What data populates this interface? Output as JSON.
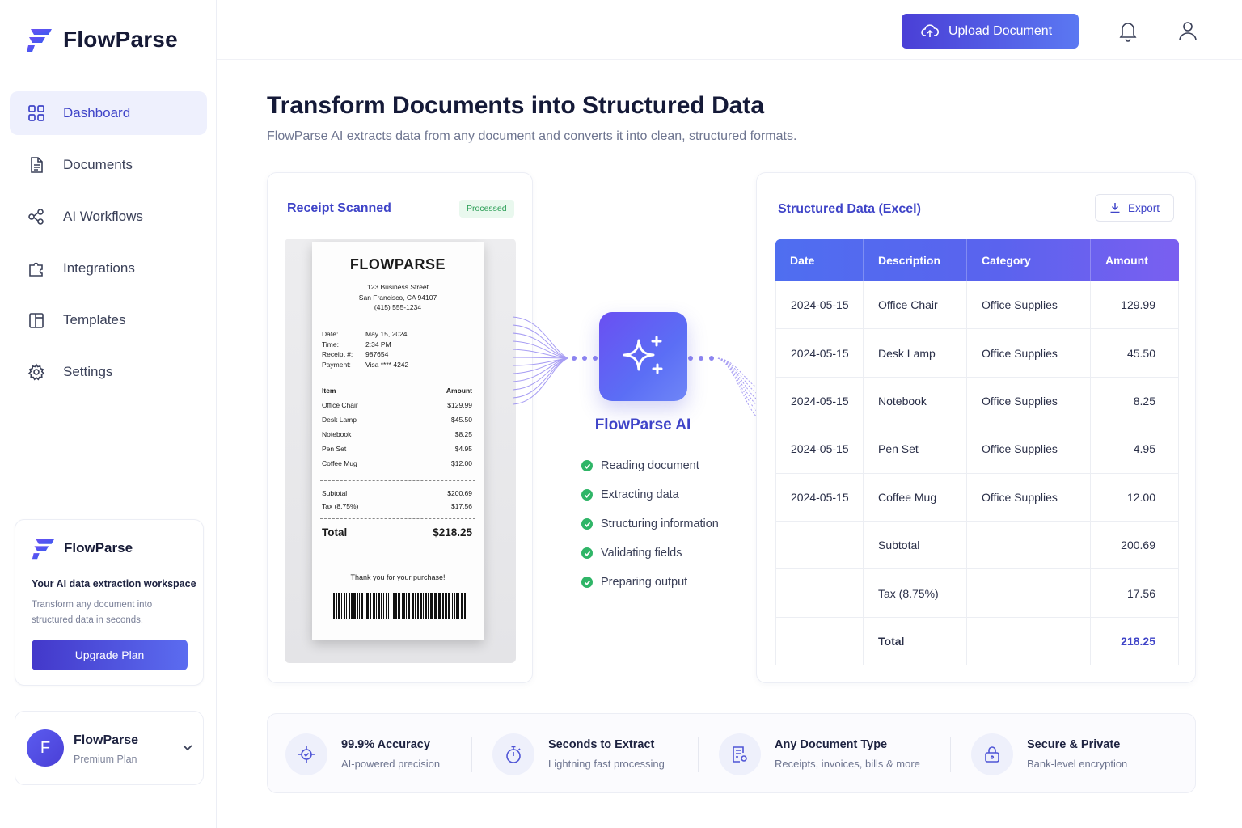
{
  "brand": {
    "name": "FlowParse"
  },
  "colors": {
    "accent": "#3f44c8",
    "success": "#2fb567",
    "primary_gradient_start": "#4a3fd6",
    "primary_gradient_end": "#5b78f2"
  },
  "sidebar": {
    "items": [
      {
        "label": "Dashboard",
        "icon": "grid-icon",
        "active": true
      },
      {
        "label": "Documents",
        "icon": "document-icon"
      },
      {
        "label": "AI Workflows",
        "icon": "workflow-icon"
      },
      {
        "label": "Integrations",
        "icon": "puzzle-icon"
      },
      {
        "label": "Templates",
        "icon": "template-icon"
      },
      {
        "label": "Settings",
        "icon": "gear-icon"
      }
    ],
    "promo": {
      "brand": "FlowParse",
      "title": "Your AI data extraction workspace",
      "description": "Transform any document into structured data in seconds.",
      "button": "Upgrade Plan"
    },
    "account": {
      "initial": "F",
      "name": "FlowParse",
      "plan": "Premium Plan"
    }
  },
  "topbar": {
    "upload_label": "Upload Document"
  },
  "hero": {
    "title": "Transform Documents into Structured Data",
    "subtitle": "FlowParse AI extracts data from any document and converts it into clean, structured formats."
  },
  "receipt_card": {
    "title": "Receipt Scanned",
    "badge": "Processed",
    "receipt": {
      "store": "FLOWPARSE",
      "address": [
        "123 Business Street",
        "San Francisco, CA 94107",
        "(415) 555-1234"
      ],
      "meta": [
        {
          "k": "Date:",
          "v": "May 15, 2024"
        },
        {
          "k": "Time:",
          "v": "2:34 PM"
        },
        {
          "k": "Receipt #:",
          "v": "987654"
        },
        {
          "k": "Payment:",
          "v": "Visa **** 4242"
        }
      ],
      "item_header": "Item",
      "amount_header": "Amount",
      "items": [
        {
          "name": "Office Chair",
          "amount": "$129.99"
        },
        {
          "name": "Desk Lamp",
          "amount": "$45.50"
        },
        {
          "name": "Notebook",
          "amount": "$8.25"
        },
        {
          "name": "Pen Set",
          "amount": "$4.95"
        },
        {
          "name": "Coffee Mug",
          "amount": "$12.00"
        }
      ],
      "subtotal_label": "Subtotal",
      "subtotal": "$200.69",
      "tax_label": "Tax (8.75%)",
      "tax": "$17.56",
      "total_label": "Total",
      "total": "$218.25",
      "thanks": "Thank you for your purchase!"
    }
  },
  "ai": {
    "name": "FlowParse AI",
    "steps": [
      "Reading document",
      "Extracting data",
      "Structuring information",
      "Validating fields",
      "Preparing output"
    ]
  },
  "table_card": {
    "title": "Structured Data (Excel)",
    "export_label": "Export",
    "columns": [
      "Date",
      "Description",
      "Category",
      "Amount"
    ],
    "rows": [
      [
        "2024-05-15",
        "Office Chair",
        "Office Supplies",
        "129.99"
      ],
      [
        "2024-05-15",
        "Desk Lamp",
        "Office Supplies",
        "45.50"
      ],
      [
        "2024-05-15",
        "Notebook",
        "Office Supplies",
        "8.25"
      ],
      [
        "2024-05-15",
        "Pen Set",
        "Office Supplies",
        "4.95"
      ],
      [
        "2024-05-15",
        "Coffee Mug",
        "Office Supplies",
        "12.00"
      ],
      [
        "",
        "Subtotal",
        "",
        "200.69"
      ],
      [
        "",
        "Tax (8.75%)",
        "",
        "17.56"
      ],
      [
        "",
        "Total",
        "",
        "218.25"
      ]
    ]
  },
  "features": [
    {
      "title": "99.9% Accuracy",
      "desc": "AI-powered precision",
      "icon": "target-icon"
    },
    {
      "title": "Seconds to Extract",
      "desc": "Lightning fast processing",
      "icon": "stopwatch-icon"
    },
    {
      "title": "Any Document Type",
      "desc": "Receipts, invoices, bills & more",
      "icon": "document-settings-icon"
    },
    {
      "title": "Secure & Private",
      "desc": "Bank-level encryption",
      "icon": "lock-icon"
    }
  ]
}
